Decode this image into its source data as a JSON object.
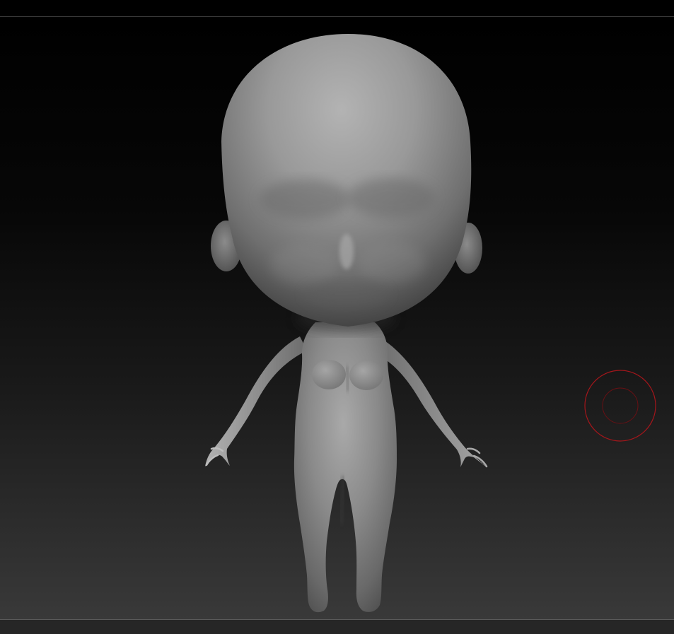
{
  "viewport": {
    "model": {
      "label": "",
      "material_color": "#8f8f8f"
    },
    "brush_cursor": {
      "icon": "brush-circle-icon",
      "color": "#a4161b"
    }
  }
}
